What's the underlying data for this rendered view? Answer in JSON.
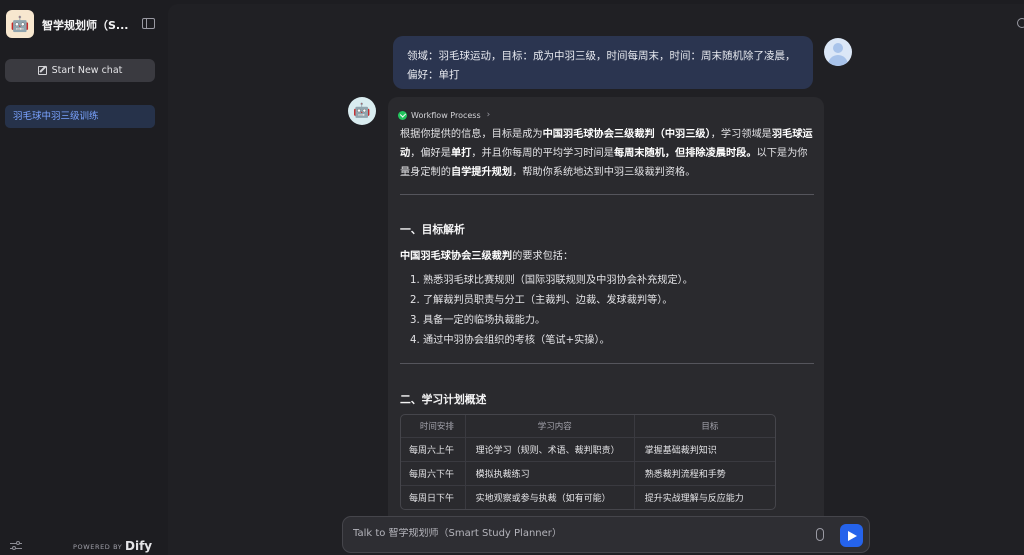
{
  "sidebar": {
    "app_title": "智学规划师（S...",
    "new_chat_label": "Start New chat",
    "conversations": [
      {
        "label": "羽毛球中羽三级训练",
        "active": true
      }
    ],
    "powered_by": "POWERED BY",
    "brand": "Dify"
  },
  "chat": {
    "user_message": "领域：羽毛球运动，目标：成为中羽三级，时间每周末，时间：周末随机除了凌晨，偏好：单打",
    "workflow_label": "Workflow Process",
    "intro": {
      "s1": "根据你提供的信息，目标是成为",
      "b1": "中国羽毛球协会三级裁判（中羽三级）",
      "s2": "，学习领域是",
      "b2": "羽毛球运动",
      "s3": "，偏好是",
      "b3": "单打",
      "s4": "，并且你每周的平均学习时间是",
      "b4": "每周末随机，但排除凌晨时段。",
      "s5": "以下是为你量身定制的",
      "b5": "自学提升规划",
      "s6": "，帮助你系统地达到中羽三级裁判资格。"
    },
    "section1_title": "一、目标解析",
    "requirements_bold": "中国羽毛球协会三级裁判",
    "requirements_rest": "的要求包括：",
    "requirements": [
      "1. 熟悉羽毛球比赛规则（国际羽联规则及中羽协会补充规定）。",
      "2. 了解裁判员职责与分工（主裁判、边裁、发球裁判等）。",
      "3. 具备一定的临场执裁能力。",
      "4. 通过中羽协会组织的考核（笔试+实操）。"
    ],
    "section2_title": "二、学习计划概述",
    "table": {
      "headers": [
        "时间安排",
        "学习内容",
        "目标"
      ],
      "rows": [
        [
          "每周六上午",
          "理论学习（规则、术语、裁判职责）",
          "掌握基础裁判知识"
        ],
        [
          "每周六下午",
          "模拟执裁练习",
          "熟悉裁判流程和手势"
        ],
        [
          "每周日下午",
          "实地观察或参与执裁（如有可能）",
          "提升实战理解与反应能力"
        ]
      ]
    }
  },
  "input": {
    "placeholder": "Talk to 智学规划师（Smart Study Planner）"
  },
  "colors": {
    "accent": "#2563eb",
    "active_item_text": "#7aa3ff",
    "success": "#22c55e"
  },
  "icons": {
    "logo": "robot-icon",
    "collapse": "sidebar-collapse-icon",
    "new_chat": "edit-icon",
    "workflow_status": "check-circle-icon",
    "attach": "paperclip-icon",
    "send": "send-icon"
  }
}
